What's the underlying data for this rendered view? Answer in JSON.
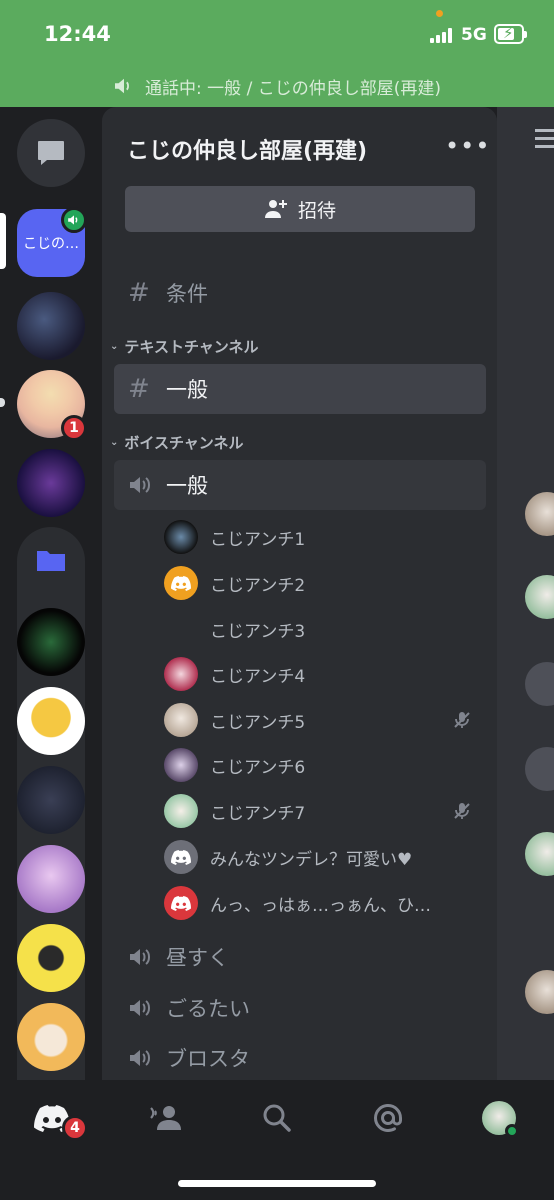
{
  "status_bar": {
    "time": "12:44",
    "network": "5G"
  },
  "call_banner": {
    "text": "通話中: 一般 / こじの仲良し部屋(再建)"
  },
  "rail": {
    "active_server_label": "こじの…",
    "mention_count": "1"
  },
  "server": {
    "name": "こじの仲良し部屋(再建)",
    "invite_label": "招待"
  },
  "channels": {
    "rules": "条件",
    "text_category": "テキストチャンネル",
    "text_general": "一般",
    "voice_category": "ボイスチャンネル",
    "voice_general": "一般",
    "voice_users": [
      {
        "name": "こじアンチ1",
        "muted": false
      },
      {
        "name": "こじアンチ2",
        "muted": false
      },
      {
        "name": "こじアンチ3",
        "muted": false
      },
      {
        "name": "こじアンチ4",
        "muted": false
      },
      {
        "name": "こじアンチ5",
        "muted": true
      },
      {
        "name": "こじアンチ6",
        "muted": false
      },
      {
        "name": "こじアンチ7",
        "muted": true
      },
      {
        "name": "みんなツンデレ？可愛い♥",
        "muted": false
      },
      {
        "name": "んっ、っはぁ…っぁん、ひ…",
        "muted": false
      }
    ],
    "voice_others": [
      "昼すく",
      "ごるたい",
      "ブロスタ"
    ]
  },
  "bottom_nav": {
    "home_badge": "4"
  },
  "colors": {
    "call_green": "#5bab5e",
    "blurple": "#5865f2",
    "mention_red": "#da373c",
    "voice_green": "#23a559",
    "orange": "#f0a020"
  }
}
